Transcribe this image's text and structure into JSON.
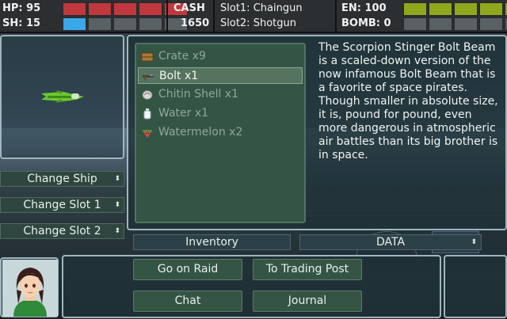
{
  "hud": {
    "hp_label": "HP: 95",
    "sh_label": "SH: 15",
    "cash_label": "CASH",
    "cash_value": "1650",
    "slot1": "Slot1: Chaingun",
    "slot2": "Slot2: Shotgun",
    "en_label": "EN: 100",
    "bomb_label": "BOMB: 0",
    "hp_bar_filled": 5,
    "sh_bar_filled": 1,
    "en_bar_filled": 5,
    "bomb_bar_filled": 0,
    "colors": {
      "hp": "#c0383e",
      "shield": "#3aa8e8",
      "energy": "#8ea81e"
    }
  },
  "selectors": {
    "change_ship": "Change Ship",
    "change_slot1": "Change Slot 1",
    "change_slot2": "Change Slot 2"
  },
  "inventory": {
    "items": [
      {
        "label": "Crate x9",
        "icon": "crate-icon",
        "selected": false
      },
      {
        "label": "Bolt x1",
        "icon": "bolt-gun-icon",
        "selected": true
      },
      {
        "label": "Chitin Shell x1",
        "icon": "chitin-shell-icon",
        "selected": false
      },
      {
        "label": "Water x1",
        "icon": "water-bottle-icon",
        "selected": false
      },
      {
        "label": "Watermelon x2",
        "icon": "watermelon-icon",
        "selected": false
      }
    ],
    "description": "The Scorpion Stinger Bolt Beam is a scaled-down version of the now infamous Bolt Beam that is a favorite of space pirates. Though smaller in absolute size, it is, pound for pound, even more dangerous in atmospheric air battles than its big brother is in space."
  },
  "tabs": {
    "inventory": "Inventory",
    "data": "DATA"
  },
  "actions": {
    "go_on_raid": "Go on Raid",
    "to_trading_post": "To Trading Post",
    "chat": "Chat",
    "journal": "Journal"
  }
}
